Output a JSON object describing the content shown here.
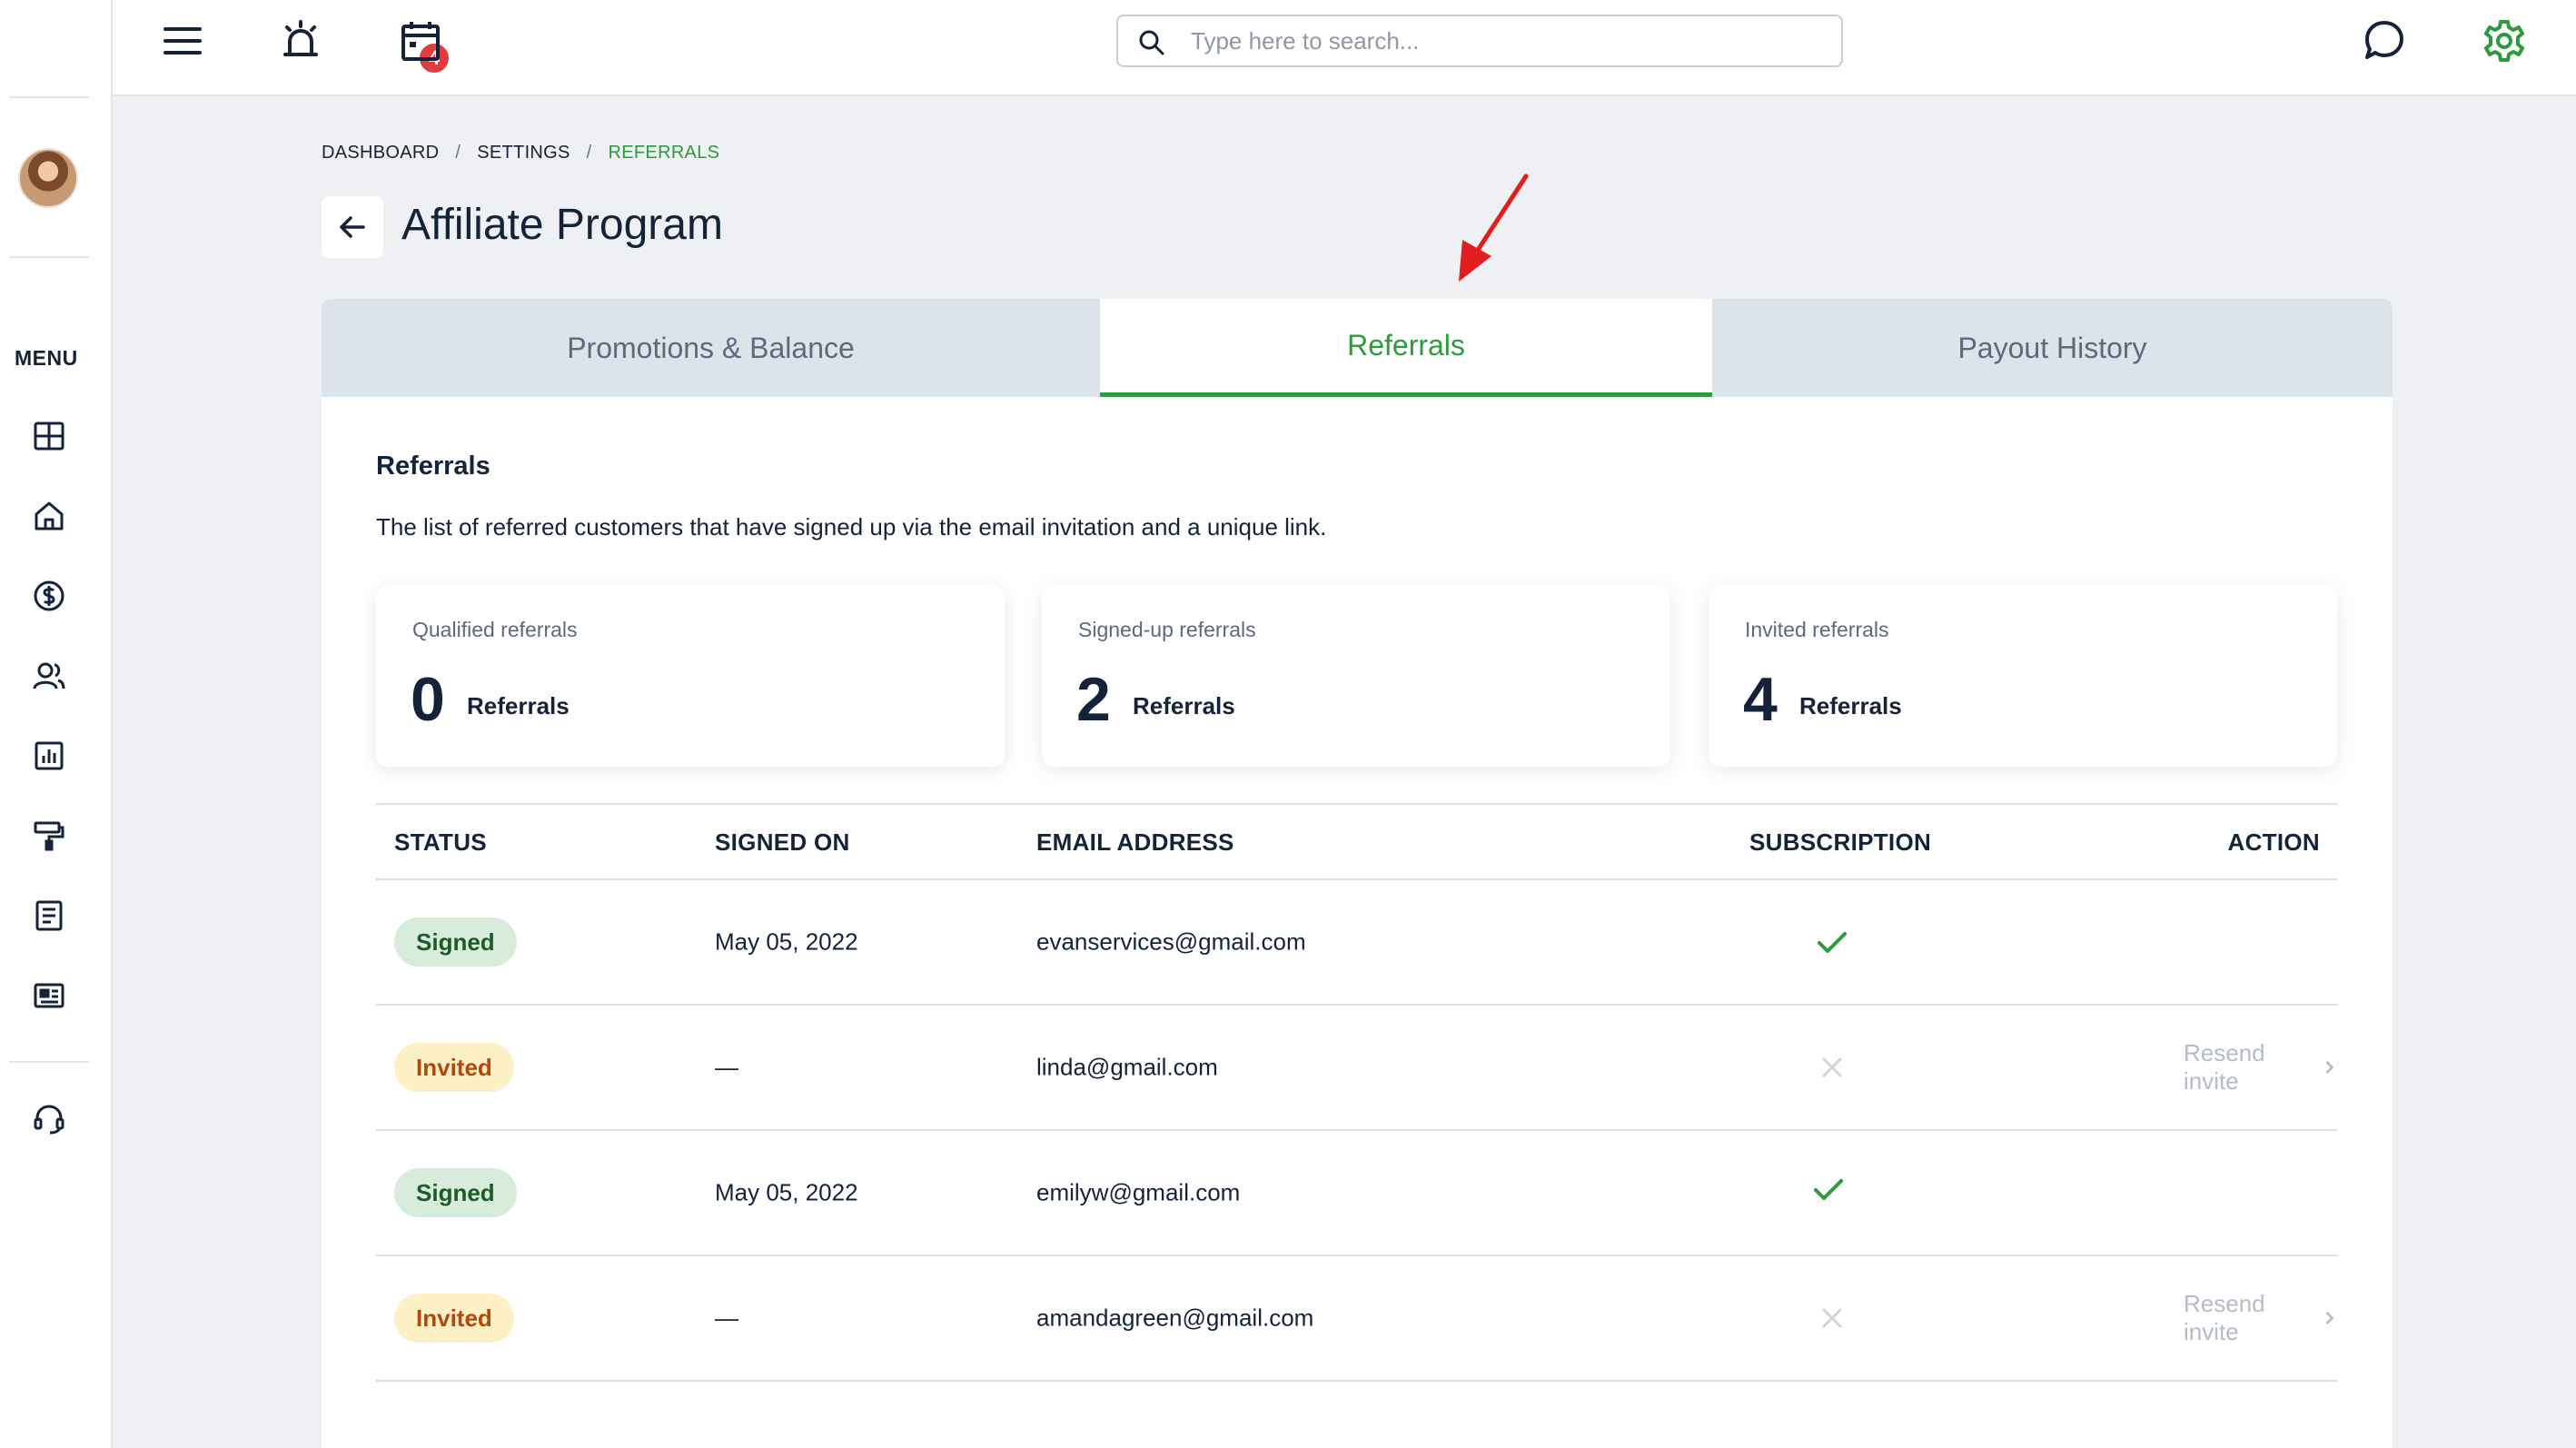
{
  "topbar": {
    "notification_count": "4",
    "search_placeholder": "Type here to search..."
  },
  "sidebar": {
    "menu_label": "MENU",
    "items": [
      {
        "icon": "dashboard-grid-icon"
      },
      {
        "icon": "home-icon"
      },
      {
        "icon": "dollar-icon"
      },
      {
        "icon": "users-icon"
      },
      {
        "icon": "bar-chart-icon"
      },
      {
        "icon": "paint-roller-icon"
      },
      {
        "icon": "document-icon"
      },
      {
        "icon": "id-card-icon"
      },
      {
        "icon": "headset-icon"
      }
    ]
  },
  "breadcrumb": {
    "items": [
      "DASHBOARD",
      "SETTINGS",
      "REFERRALS"
    ],
    "separator": "/"
  },
  "page": {
    "title": "Affiliate Program"
  },
  "tabs": [
    {
      "label": "Promotions & Balance",
      "active": false
    },
    {
      "label": "Referrals",
      "active": true
    },
    {
      "label": "Payout History",
      "active": false
    }
  ],
  "section": {
    "title": "Referrals",
    "description": "The list of referred customers that have signed up via the email invitation and a unique link."
  },
  "stats": [
    {
      "label": "Qualified referrals",
      "value": "0",
      "unit": "Referrals"
    },
    {
      "label": "Signed-up referrals",
      "value": "2",
      "unit": "Referrals"
    },
    {
      "label": "Invited referrals",
      "value": "4",
      "unit": "Referrals"
    }
  ],
  "table": {
    "headers": {
      "status": "STATUS",
      "signed_on": "SIGNED ON",
      "email": "EMAIL ADDRESS",
      "subscription": "SUBSCRIPTION",
      "action": "ACTION"
    },
    "rows": [
      {
        "status": "Signed",
        "signed_on": "May 05, 2022",
        "email": "evanservices@gmail.com",
        "subscription": true,
        "action": ""
      },
      {
        "status": "Invited",
        "signed_on": "—",
        "email": "linda@gmail.com",
        "subscription": false,
        "action": "Resend invite"
      },
      {
        "status": "Signed",
        "signed_on": "May 05, 2022",
        "email": "emilyw@gmail.com",
        "subscription": true,
        "action": ""
      },
      {
        "status": "Invited",
        "signed_on": "—",
        "email": "amandagreen@gmail.com",
        "subscription": false,
        "action": "Resend invite"
      }
    ]
  },
  "colors": {
    "accent_green": "#2e9a3e",
    "annotation_red": "#e11d1d",
    "badge_red": "#e23c3c"
  }
}
